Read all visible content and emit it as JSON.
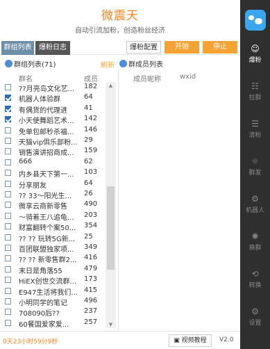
{
  "header": {
    "title": "微震天",
    "subtitle": "自动引流加粉，创造粉丝经济"
  },
  "tabs": {
    "group_list": "群组列表",
    "log": "爆粉日志"
  },
  "buttons": {
    "config": "爆粉配置",
    "start": "开始",
    "stop": "停止"
  },
  "groups": {
    "header": "群组列表(71)",
    "refresh": "刷新",
    "col_name": "群名",
    "col_count": "成员",
    "rows": [
      {
        "checked": false,
        "name": "??月亮岛文化艺...",
        "count": "182"
      },
      {
        "checked": true,
        "name": "机器人体验群",
        "count": "64"
      },
      {
        "checked": true,
        "name": "有偶货的代理进",
        "count": "41"
      },
      {
        "checked": true,
        "name": "小天使舞蹈艺术...",
        "count": "142"
      },
      {
        "checked": false,
        "name": "免单包邮秒杀福...",
        "count": "146"
      },
      {
        "checked": false,
        "name": "天猫vip俱乐部粉...",
        "count": "29"
      },
      {
        "checked": false,
        "name": "销售演讲招商成...",
        "count": "159"
      },
      {
        "checked": false,
        "name": "666",
        "count": "62"
      },
      {
        "checked": false,
        "name": "内乡县天下第一...",
        "count": "103"
      },
      {
        "checked": false,
        "name": "分享朋友",
        "count": "64"
      },
      {
        "checked": false,
        "name": "?? 33～阳光生...",
        "count": "26"
      },
      {
        "checked": false,
        "name": "微享云商新零售",
        "count": "490"
      },
      {
        "checked": false,
        "name": "～骑着王八追龟...",
        "count": "203"
      },
      {
        "checked": false,
        "name": "财富翻转个案50...",
        "count": "354"
      },
      {
        "checked": false,
        "name": "?? ?? 玩转5G新...",
        "count": "25"
      },
      {
        "checked": false,
        "name": "百团联盟独家项...",
        "count": "349"
      },
      {
        "checked": false,
        "name": "?? ?? 新零售群2...",
        "count": "416"
      },
      {
        "checked": false,
        "name": "末日是角落55",
        "count": "479"
      },
      {
        "checked": false,
        "name": "HiEX创世交流群...",
        "count": "173"
      },
      {
        "checked": false,
        "name": "E947生活将我们...",
        "count": "415"
      },
      {
        "checked": false,
        "name": "小明同学的笔记",
        "count": "496"
      },
      {
        "checked": false,
        "name": "708090后??",
        "count": "237"
      },
      {
        "checked": false,
        "name": "60餐国爱家爱...",
        "count": "257"
      }
    ]
  },
  "members": {
    "header": "群成员列表",
    "col_nick": "成员昵称",
    "col_wxid": "wxid"
  },
  "footer": {
    "timer": "0天23小时59分9秒",
    "video": "视频教程",
    "version": "V2.0"
  },
  "sidebar": [
    {
      "label": "爆粉",
      "icon": "user-icon",
      "active": true
    },
    {
      "label": "拉群",
      "icon": "group-icon",
      "active": false
    },
    {
      "label": "清粉",
      "icon": "clean-icon",
      "active": false
    },
    {
      "label": "群发",
      "icon": "broadcast-icon",
      "active": false
    },
    {
      "label": "机器人",
      "icon": "robot-icon",
      "active": false
    },
    {
      "label": "换群",
      "icon": "switch-icon",
      "active": false
    },
    {
      "label": "转换",
      "icon": "convert-icon",
      "active": false
    },
    {
      "label": "设置",
      "icon": "settings-icon",
      "active": false
    }
  ]
}
